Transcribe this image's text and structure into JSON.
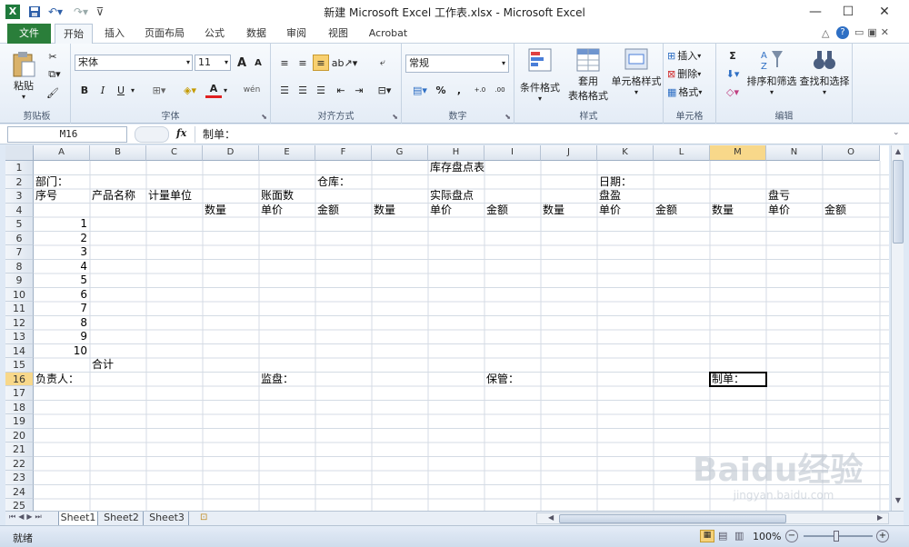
{
  "window": {
    "title": "新建 Microsoft Excel 工作表.xlsx - Microsoft Excel",
    "app_icon": "X"
  },
  "quick_access": {
    "save": "save-icon",
    "undo": "undo-icon",
    "redo": "redo-icon",
    "customize": "customize-icon"
  },
  "tabs": [
    "文件",
    "开始",
    "插入",
    "页面布局",
    "公式",
    "数据",
    "审阅",
    "视图",
    "Acrobat"
  ],
  "ribbon": {
    "clipboard": {
      "paste": "粘贴",
      "label": "剪贴板"
    },
    "font": {
      "name": "宋体",
      "size": "11",
      "bold": "B",
      "italic": "I",
      "underline": "U",
      "grow": "A",
      "shrink": "A",
      "color_a": "A",
      "wen": "wén",
      "label": "字体"
    },
    "align": {
      "label": "对齐方式"
    },
    "number": {
      "format": "常规",
      "percent": "%",
      "comma": ",",
      "inc": "+.0",
      "dec": ".00",
      "label": "数字"
    },
    "styles": {
      "cond": "条件格式",
      "table1": "套用",
      "table2": "表格格式",
      "cellstyle": "单元格样式",
      "label": "样式"
    },
    "cells": {
      "insert": "插入",
      "delete": "删除",
      "format": "格式",
      "label": "单元格"
    },
    "edit": {
      "sum": "Σ",
      "sort": "排序和筛选",
      "find": "查找和选择",
      "label": "编辑"
    }
  },
  "formula_bar": {
    "name_box": "M16",
    "fx": "fx",
    "content": "制单："
  },
  "columns": [
    "A",
    "B",
    "C",
    "D",
    "E",
    "F",
    "G",
    "H",
    "I",
    "J",
    "K",
    "L",
    "M",
    "N",
    "O"
  ],
  "rows": [
    "1",
    "2",
    "3",
    "4",
    "5",
    "6",
    "7",
    "8",
    "9",
    "10",
    "11",
    "12",
    "13",
    "14",
    "15",
    "16",
    "17",
    "18",
    "19",
    "20",
    "21",
    "22",
    "23",
    "24",
    "25"
  ],
  "selected": {
    "col": "M",
    "row": "16"
  },
  "cells": {
    "H1": "库存盘点表",
    "A2": "部门：",
    "F2": "仓库：",
    "K2": "日期：",
    "A3": "序号",
    "B3": "产品名称",
    "C3": "计量单位",
    "E3": "账面数",
    "H3": "实际盘点",
    "K3": "盘盈",
    "N3": "盘亏",
    "D4": "数量",
    "E4": "单价",
    "F4": "金额",
    "G4": "数量",
    "H4": "单价",
    "I4": "金额",
    "J4": "数量",
    "K4": "单价",
    "L4": "金额",
    "M4": "数量",
    "N4": "单价",
    "O4": "金额",
    "A5": "1",
    "A6": "2",
    "A7": "3",
    "A8": "4",
    "A9": "5",
    "A10": "6",
    "A11": "7",
    "A12": "8",
    "A13": "9",
    "A14": "10",
    "B15": "合计",
    "A16": "负责人：",
    "E16": "监盘：",
    "I16": "保管：",
    "M16": "制单："
  },
  "sheets": [
    "Sheet1",
    "Sheet2",
    "Sheet3"
  ],
  "status": {
    "ready": "就绪",
    "zoom": "100%"
  },
  "watermark": "Baidu经验",
  "watermark_sub": "jingyan.baidu.com"
}
